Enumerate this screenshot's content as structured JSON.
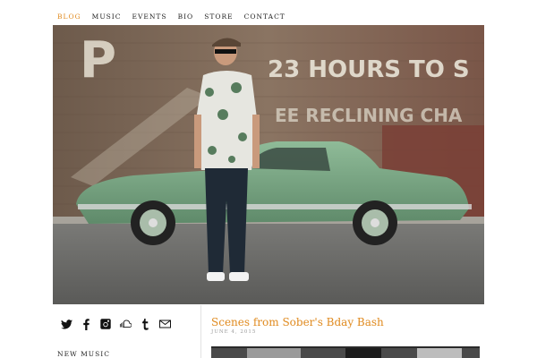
{
  "nav": {
    "items": [
      {
        "label": "BLOG",
        "active": true
      },
      {
        "label": "MUSIC"
      },
      {
        "label": "EVENTS"
      },
      {
        "label": "BIO"
      },
      {
        "label": "STORE"
      },
      {
        "label": "CONTACT"
      }
    ]
  },
  "hero": {
    "wall_text_1": "23 HOURS TO S",
    "wall_text_2": "EE RECLINING CHA",
    "wall_letter": "P"
  },
  "sidebar": {
    "social_icons": [
      "twitter-icon",
      "facebook-icon",
      "instagram-icon",
      "soundcloud-icon",
      "tumblr-icon",
      "mail-icon"
    ],
    "section_label": "NEW MUSIC"
  },
  "post": {
    "title": "Scenes from Sober's Bday Bash",
    "date": "JUNE 4, 2015"
  },
  "colors": {
    "accent": "#e08a1e",
    "car": "#7aa882"
  }
}
